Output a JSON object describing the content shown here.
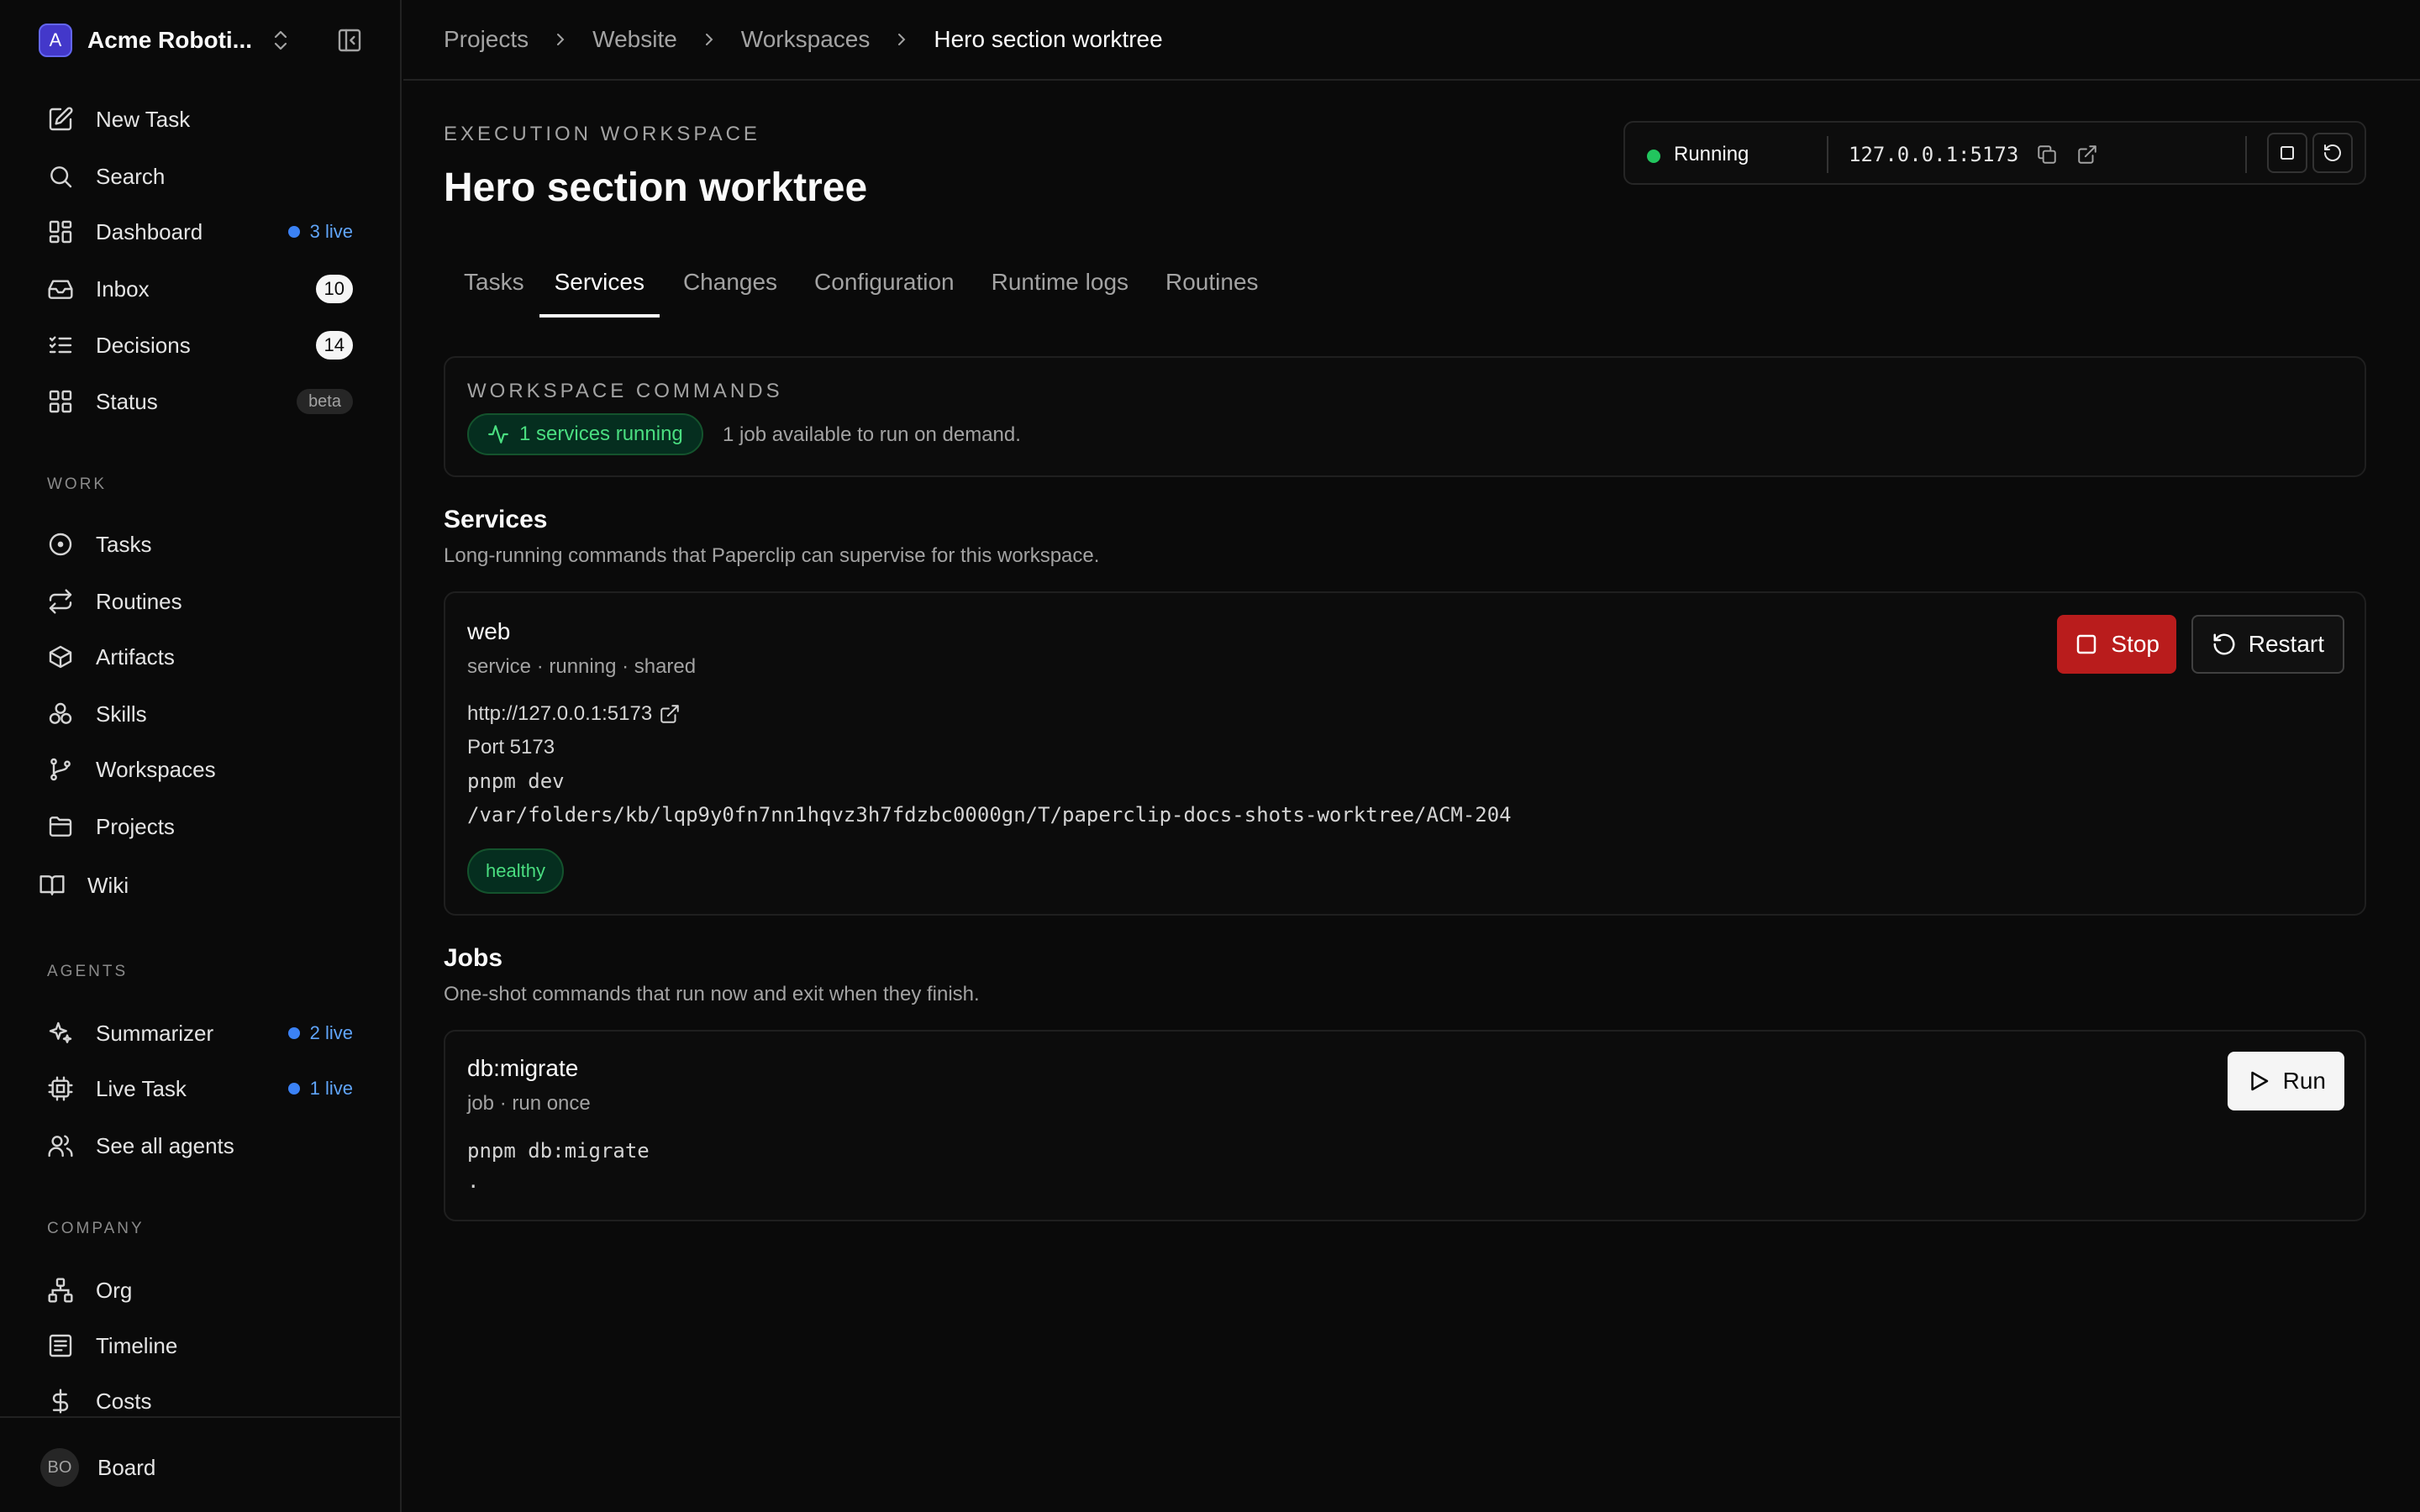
{
  "sidebar": {
    "company_initial": "A",
    "company_name": "Acme Roboti...",
    "nav": [
      {
        "label": "New Task",
        "icon": "edit-icon"
      },
      {
        "label": "Search",
        "icon": "search-icon"
      },
      {
        "label": "Dashboard",
        "icon": "dashboard-icon",
        "live": "3 live"
      },
      {
        "label": "Inbox",
        "icon": "inbox-icon",
        "count": "10"
      },
      {
        "label": "Decisions",
        "icon": "list-check-icon",
        "count": "14"
      },
      {
        "label": "Status",
        "icon": "grid-icon",
        "tag": "beta"
      }
    ],
    "work_label": "WORK",
    "work": [
      {
        "label": "Tasks",
        "icon": "circle-dot-icon"
      },
      {
        "label": "Routines",
        "icon": "repeat-icon"
      },
      {
        "label": "Artifacts",
        "icon": "package-icon"
      },
      {
        "label": "Skills",
        "icon": "boxes-icon"
      },
      {
        "label": "Workspaces",
        "icon": "git-branch-icon"
      },
      {
        "label": "Projects",
        "icon": "folder-icon"
      },
      {
        "label": "Wiki",
        "icon": "book-icon"
      }
    ],
    "agents_label": "AGENTS",
    "agents": [
      {
        "label": "Summarizer",
        "icon": "sparkles-icon",
        "live": "2 live"
      },
      {
        "label": "Live Task",
        "icon": "cpu-icon",
        "live": "1 live"
      },
      {
        "label": "See all agents",
        "icon": "users-icon"
      }
    ],
    "company_label": "COMPANY",
    "company_items": [
      {
        "label": "Org",
        "icon": "org-chart-icon"
      },
      {
        "label": "Timeline",
        "icon": "timeline-icon"
      },
      {
        "label": "Costs",
        "icon": "dollar-icon"
      }
    ],
    "user_initials": "BO",
    "user_name": "Board"
  },
  "breadcrumb": [
    "Projects",
    "Website",
    "Workspaces",
    "Hero section worktree"
  ],
  "header": {
    "eyebrow": "EXECUTION WORKSPACE",
    "title": "Hero section worktree"
  },
  "status_panel": {
    "status": "Running",
    "url": "127.0.0.1:5173"
  },
  "tabs": [
    "Tasks",
    "Services",
    "Changes",
    "Configuration",
    "Runtime logs",
    "Routines"
  ],
  "active_tab": "Services",
  "commands": {
    "title": "WORKSPACE COMMANDS",
    "services_running": "1 services running",
    "jobs_note": "1 job available to run on demand."
  },
  "services": {
    "title": "Services",
    "description": "Long-running commands that Paperclip can supervise for this workspace.",
    "items": [
      {
        "name": "web",
        "meta": "service · running · shared",
        "url": "http://127.0.0.1:5173",
        "port": "Port 5173",
        "command": "pnpm dev",
        "cwd": "/var/folders/kb/lqp9y0fn7nn1hqvz3h7fdzbc0000gn/T/paperclip-docs-shots-worktree/ACM-204",
        "health": "healthy",
        "stop_label": "Stop",
        "restart_label": "Restart"
      }
    ]
  },
  "jobs": {
    "title": "Jobs",
    "description": "One-shot commands that run now and exit when they finish.",
    "items": [
      {
        "name": "db:migrate",
        "meta": "job · run once",
        "command": "pnpm db:migrate",
        "cwd": ".",
        "run_label": "Run"
      }
    ]
  },
  "colors": {
    "background": "#0a0a0a",
    "running_dot": "#22c55e",
    "live_dot": "#3b82f6",
    "stop_button": "#b91c1c",
    "healthy_text": "#4ade80"
  }
}
